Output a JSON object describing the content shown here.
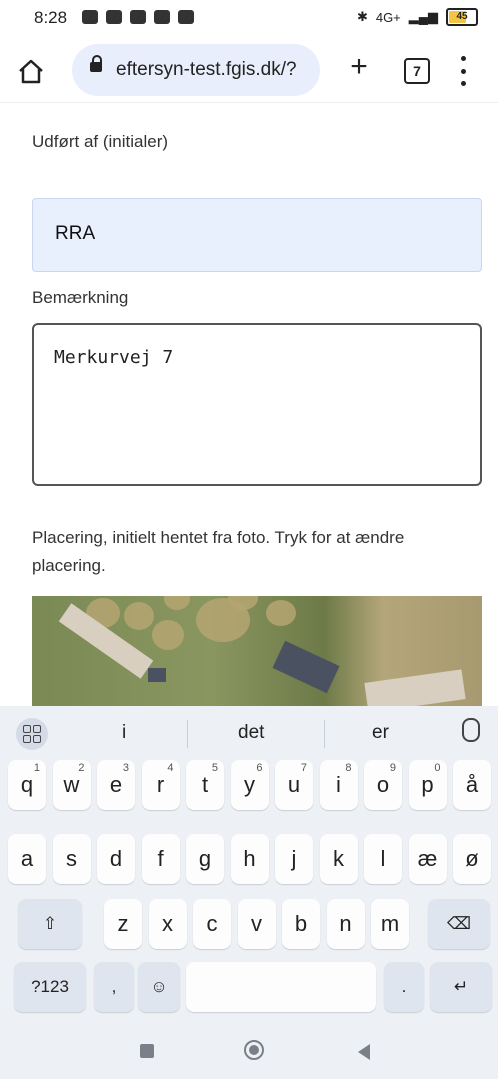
{
  "status_bar": {
    "time": "8:28",
    "network": "4G+",
    "battery": "45"
  },
  "browser": {
    "url": "eftersyn-test.fgis.dk/?",
    "tab_count": "7",
    "new_tab_symbol": "+"
  },
  "form": {
    "initials_label": "Udført af (initialer)",
    "initials_value": "RRA",
    "remark_label": "Bemærkning",
    "remark_value": "Merkurvej 7",
    "placement_text": "Placering, initielt hentet fra foto. Tryk for at ændre placering."
  },
  "keyboard": {
    "suggestions": [
      "i",
      "det",
      "er"
    ],
    "row1": [
      "q",
      "w",
      "e",
      "r",
      "t",
      "y",
      "u",
      "i",
      "o",
      "p",
      "å"
    ],
    "row1_hints": [
      "1",
      "2",
      "3",
      "4",
      "5",
      "6",
      "7",
      "8",
      "9",
      "0",
      ""
    ],
    "row2": [
      "a",
      "s",
      "d",
      "f",
      "g",
      "h",
      "j",
      "k",
      "l",
      "æ",
      "ø"
    ],
    "row3": [
      "z",
      "x",
      "c",
      "v",
      "b",
      "n",
      "m"
    ],
    "symbols_key": "?123",
    "comma_key": ",",
    "period_key": "."
  }
}
